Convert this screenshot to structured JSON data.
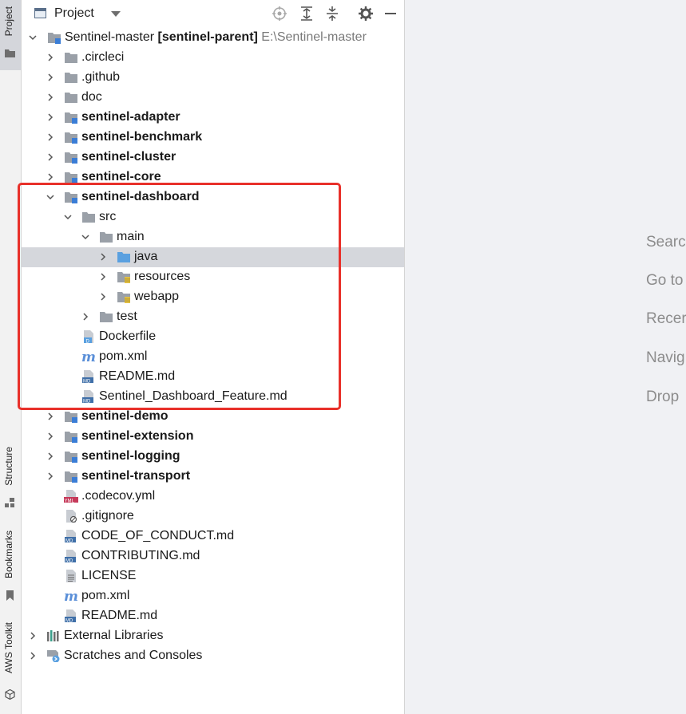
{
  "left_strip": {
    "tabs": [
      {
        "label": "Project",
        "icon": "folder-icon",
        "active": true
      },
      {
        "label": "Structure",
        "icon": "structure-icon",
        "active": false
      },
      {
        "label": "Bookmarks",
        "icon": "bookmark-icon",
        "active": false
      },
      {
        "label": "AWS Toolkit",
        "icon": "cube-icon",
        "active": false
      }
    ]
  },
  "panel": {
    "title": "Project",
    "toolbar_icons": [
      "locate-icon",
      "expand-all-icon",
      "collapse-all-icon",
      "gear-icon",
      "minimize-icon"
    ]
  },
  "tree": {
    "root": {
      "name": "Sentinel-master",
      "module": "[sentinel-parent]",
      "path": "E:\\Sentinel-master"
    },
    "items": [
      {
        "label": ".circleci",
        "icon": "folder-icon",
        "bold": false
      },
      {
        "label": ".github",
        "icon": "folder-icon",
        "bold": false
      },
      {
        "label": "doc",
        "icon": "folder-icon",
        "bold": false
      },
      {
        "label": "sentinel-adapter",
        "icon": "module-folder-icon",
        "bold": true
      },
      {
        "label": "sentinel-benchmark",
        "icon": "module-folder-icon",
        "bold": true
      },
      {
        "label": "sentinel-cluster",
        "icon": "module-folder-icon",
        "bold": true
      },
      {
        "label": "sentinel-core",
        "icon": "module-folder-icon",
        "bold": true
      },
      {
        "label": "sentinel-dashboard",
        "icon": "module-folder-icon",
        "bold": true
      },
      {
        "label": "src",
        "icon": "folder-icon",
        "bold": false
      },
      {
        "label": "main",
        "icon": "folder-icon",
        "bold": false
      },
      {
        "label": "java",
        "icon": "source-folder-icon",
        "bold": false
      },
      {
        "label": "resources",
        "icon": "resources-folder-icon",
        "bold": false
      },
      {
        "label": "webapp",
        "icon": "resources-folder-icon",
        "bold": false
      },
      {
        "label": "test",
        "icon": "folder-icon",
        "bold": false
      },
      {
        "label": "Dockerfile",
        "icon": "docker-file-icon",
        "bold": false
      },
      {
        "label": "pom.xml",
        "icon": "maven-icon",
        "bold": false
      },
      {
        "label": "README.md",
        "icon": "markdown-file-icon",
        "bold": false
      },
      {
        "label": "Sentinel_Dashboard_Feature.md",
        "icon": "markdown-file-icon",
        "bold": false
      },
      {
        "label": "sentinel-demo",
        "icon": "module-folder-icon",
        "bold": true
      },
      {
        "label": "sentinel-extension",
        "icon": "module-folder-icon",
        "bold": true
      },
      {
        "label": "sentinel-logging",
        "icon": "module-folder-icon",
        "bold": true
      },
      {
        "label": "sentinel-transport",
        "icon": "module-folder-icon",
        "bold": true
      },
      {
        "label": ".codecov.yml",
        "icon": "yml-file-icon",
        "bold": false
      },
      {
        "label": ".gitignore",
        "icon": "gitignore-file-icon",
        "bold": false
      },
      {
        "label": "CODE_OF_CONDUCT.md",
        "icon": "markdown-file-icon",
        "bold": false
      },
      {
        "label": "CONTRIBUTING.md",
        "icon": "markdown-file-icon",
        "bold": false
      },
      {
        "label": "LICENSE",
        "icon": "text-file-icon",
        "bold": false
      },
      {
        "label": "pom.xml",
        "icon": "maven-icon",
        "bold": false
      },
      {
        "label": "README.md",
        "icon": "markdown-file-icon",
        "bold": false
      },
      {
        "label": "External Libraries",
        "icon": "libraries-icon",
        "bold": false
      },
      {
        "label": "Scratches and Consoles",
        "icon": "scratches-icon",
        "bold": false
      }
    ]
  },
  "editor_hints": [
    "Searc",
    "Go to",
    "Recer",
    "Navig",
    "Drop"
  ],
  "colors": {
    "highlight_box": "#e8302a",
    "selection": "#d5d7dc",
    "folder": "#9aa0a8",
    "source_folder": "#5aa0e0",
    "module_marker": "#3a7dd6"
  }
}
